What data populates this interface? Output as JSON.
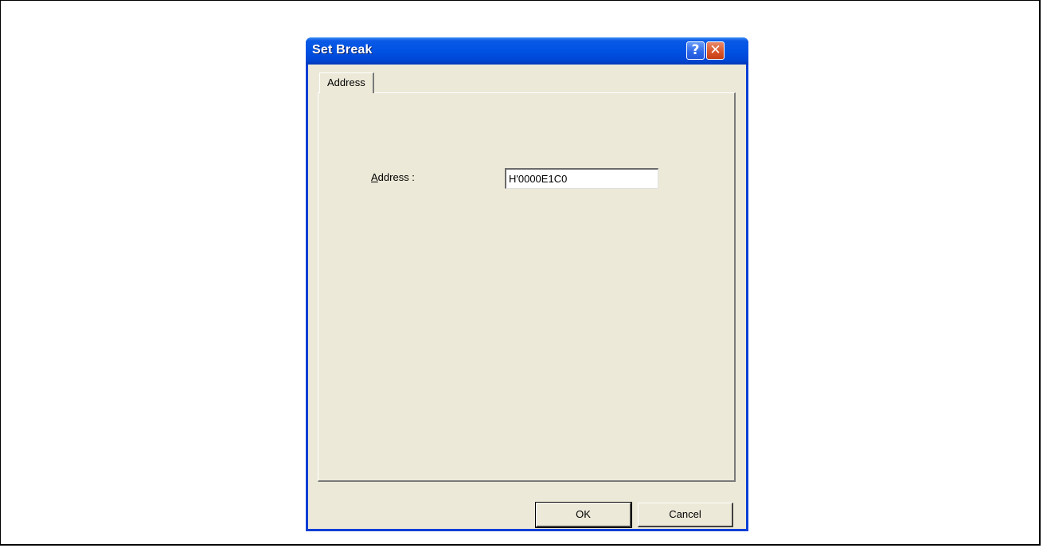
{
  "dialog": {
    "title": "Set Break",
    "help_button_glyph": "?",
    "close_button_glyph": "✕",
    "tabs": [
      {
        "label": "Address",
        "selected": true
      }
    ],
    "address_field": {
      "label_accel": "A",
      "label_rest": "ddress :",
      "value": "H'0000E1C0"
    },
    "buttons": {
      "ok_label": "OK",
      "cancel_label": "Cancel"
    },
    "colors": {
      "titlebar": "#0052e3",
      "face": "#ece9d8",
      "close_button": "#d9572b"
    },
    "icons": {
      "help": "help-icon",
      "close": "close-icon"
    }
  }
}
